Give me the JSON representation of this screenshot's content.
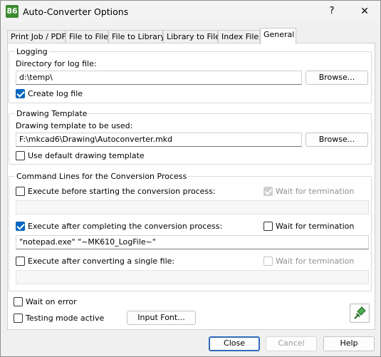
{
  "window": {
    "app_icon_text": "86",
    "title": "Auto-Converter Options",
    "help_glyph": "?",
    "close_glyph": "✕"
  },
  "tabs": [
    {
      "label": "Print Job / PDF"
    },
    {
      "label": "File to File"
    },
    {
      "label": "File to Library"
    },
    {
      "label": "Library to File"
    },
    {
      "label": "Index File"
    },
    {
      "label": "General",
      "active": true
    }
  ],
  "logging": {
    "group_label": "Logging",
    "dir_label": "Directory for log file:",
    "dir_value": "d:\\temp\\",
    "browse_label": "Browse...",
    "create_log_label": "Create log file",
    "create_log_checked": true
  },
  "drawing_template": {
    "group_label": "Drawing Template",
    "template_label": "Drawing template to be used:",
    "template_value": "F:\\mkcad6\\Drawing\\Autoconverter.mkd",
    "browse_label": "Browse...",
    "use_default_label": "Use default drawing template",
    "use_default_checked": false
  },
  "command_lines": {
    "group_label": "Command Lines for the Conversion Process",
    "before": {
      "label": "Execute before starting the conversion process:",
      "checked": false,
      "wait_label": "Wait for termination",
      "wait_checked": true,
      "wait_enabled": false,
      "command": ""
    },
    "after": {
      "label": "Execute after completing the conversion process:",
      "checked": true,
      "wait_label": "Wait for termination",
      "wait_checked": false,
      "wait_enabled": true,
      "command": "\"notepad.exe\" \"~MK610_LogFile~\""
    },
    "single": {
      "label": "Execute after converting a single file:",
      "checked": false,
      "wait_label": "Wait for termination",
      "wait_checked": false,
      "wait_enabled": false,
      "command": ""
    }
  },
  "options": {
    "wait_on_error_label": "Wait on error",
    "wait_on_error_checked": false,
    "testing_mode_label": "Testing mode active",
    "testing_mode_checked": false,
    "input_font_label": "Input Font...",
    "pin_icon": "pin-icon"
  },
  "footer": {
    "close_label": "Close",
    "cancel_label": "Cancel",
    "help_label": "Help"
  },
  "colors": {
    "accent": "#0067c0",
    "app_icon_bg": "#3c8a2e",
    "window_bg": "#f0f0f0"
  }
}
